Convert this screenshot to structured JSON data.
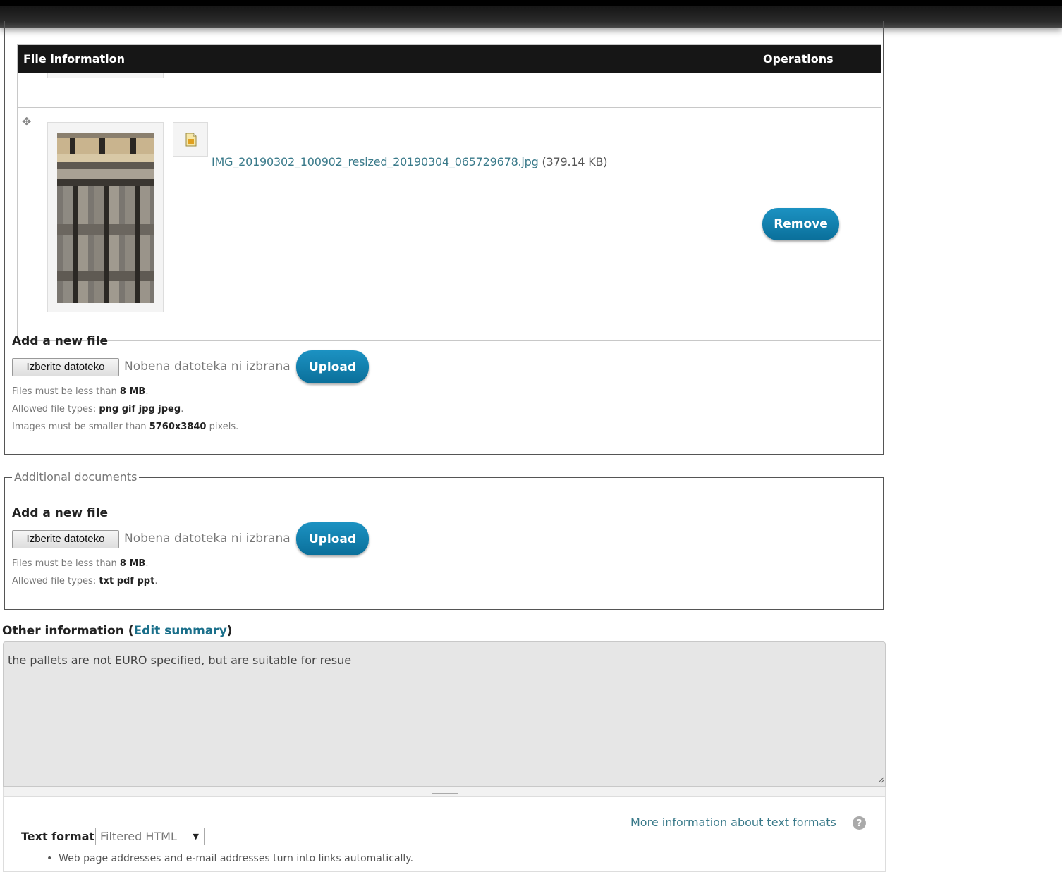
{
  "file_table": {
    "header_file_info": "File information",
    "header_operations": "Operations",
    "file": {
      "name": "IMG_20190302_100902_resized_20190304_065729678.jpg",
      "size": "(379.14 KB)"
    },
    "remove_label": "Remove"
  },
  "images_upload": {
    "add_label": "Add a new file",
    "choose_label": "Izberite datoteko",
    "no_file_label": "Nobena datoteka ni izbrana",
    "upload_label": "Upload",
    "size_text": "Files must be less than",
    "size_value": "8 MB",
    "types_text": "Allowed file types:",
    "types_value": "png gif jpg jpeg",
    "dims_text": "Images must be smaller than",
    "dims_value": "5760x3840",
    "dims_suffix": "pixels."
  },
  "documents_upload": {
    "legend": "Additional documents",
    "add_label": "Add a new file",
    "choose_label": "Izberite datoteko",
    "no_file_label": "Nobena datoteka ni izbrana",
    "upload_label": "Upload",
    "size_text": "Files must be less than",
    "size_value": "8 MB",
    "types_text": "Allowed file types:",
    "types_value": "txt pdf ppt"
  },
  "other_info": {
    "label": "Other information",
    "edit_summary": "Edit summary",
    "value": "the pallets are not EURO specified, but are suitable for resue"
  },
  "text_format": {
    "more_info": "More information about text formats",
    "label": "Text format",
    "selected": "Filtered HTML",
    "tip": "Web page addresses and e-mail addresses turn into links automatically."
  },
  "icons": {
    "drag": "move-cross-icon",
    "file": "image-file-icon",
    "help": "question-circle-icon",
    "caret": "triangle-down-icon"
  },
  "colors": {
    "header_bg": "#161616",
    "button_blue": "#0a7fb0",
    "link": "#3a7a8a",
    "textarea_bg": "#e6e6e6"
  }
}
